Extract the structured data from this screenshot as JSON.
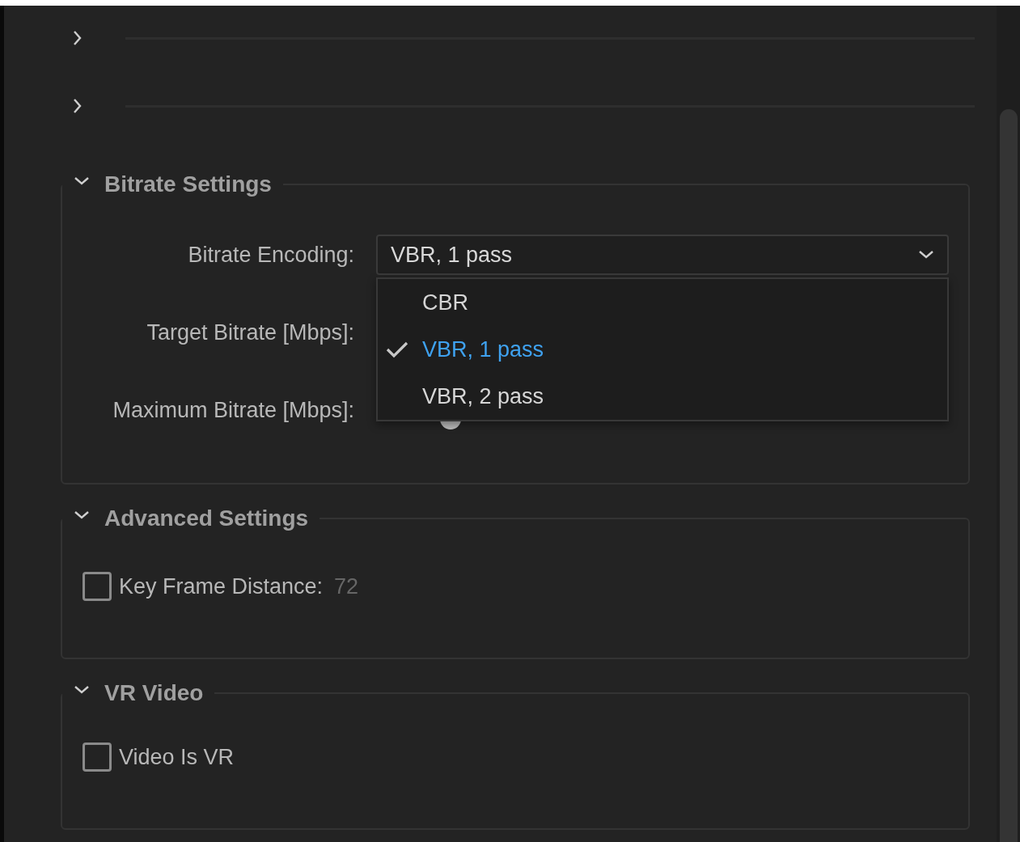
{
  "collapsed_sections": [
    {
      "expanded": false
    },
    {
      "expanded": false
    }
  ],
  "groups": [
    {
      "title": "Bitrate Settings",
      "expanded": true,
      "rows": [
        {
          "kind": "dropdown",
          "label": "Bitrate Encoding:",
          "value": "VBR, 1 pass",
          "open": true,
          "options": [
            {
              "label": "CBR",
              "selected": false
            },
            {
              "label": "VBR, 1 pass",
              "selected": true
            },
            {
              "label": "VBR, 2 pass",
              "selected": false
            }
          ]
        },
        {
          "kind": "covered",
          "label": "Target Bitrate [Mbps]:"
        },
        {
          "kind": "slider",
          "label": "Maximum Bitrate [Mbps]:",
          "level": 0.13
        }
      ]
    },
    {
      "title": "Advanced Settings",
      "expanded": true,
      "rows": [
        {
          "kind": "checkbox",
          "label": "Key Frame Distance:",
          "value": "72",
          "checked": false
        }
      ]
    },
    {
      "title": "VR Video",
      "expanded": true,
      "rows": [
        {
          "kind": "checkbox",
          "label": "Video Is VR",
          "checked": false
        }
      ]
    }
  ]
}
